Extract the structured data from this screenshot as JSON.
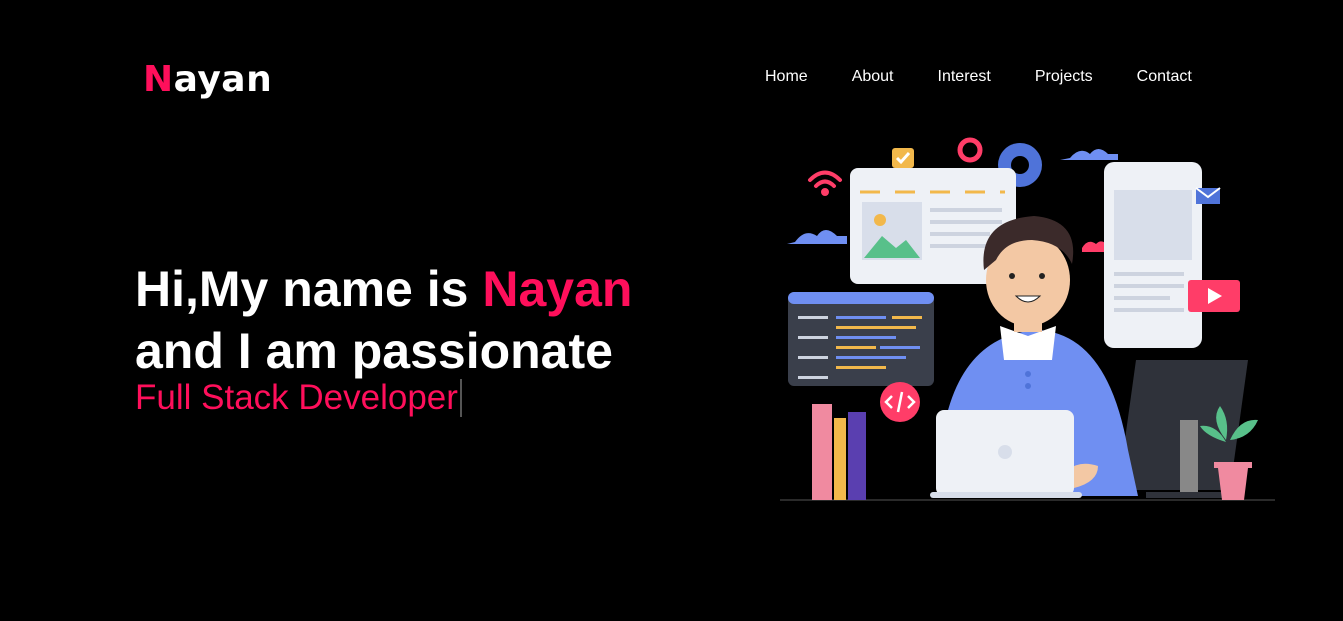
{
  "brand": {
    "first": "N",
    "rest": "ayan"
  },
  "nav": [
    {
      "label": "Home"
    },
    {
      "label": "About"
    },
    {
      "label": "Interest"
    },
    {
      "label": "Projects"
    },
    {
      "label": "Contact"
    }
  ],
  "hero": {
    "line1_prefix": "Hi,My name is ",
    "line1_name": "Nayan",
    "line2": "and I am passionate",
    "typed_text": "Full Stack Developer"
  },
  "colors": {
    "accent": "#ff0f5b",
    "background": "#000000",
    "text": "#ffffff"
  }
}
